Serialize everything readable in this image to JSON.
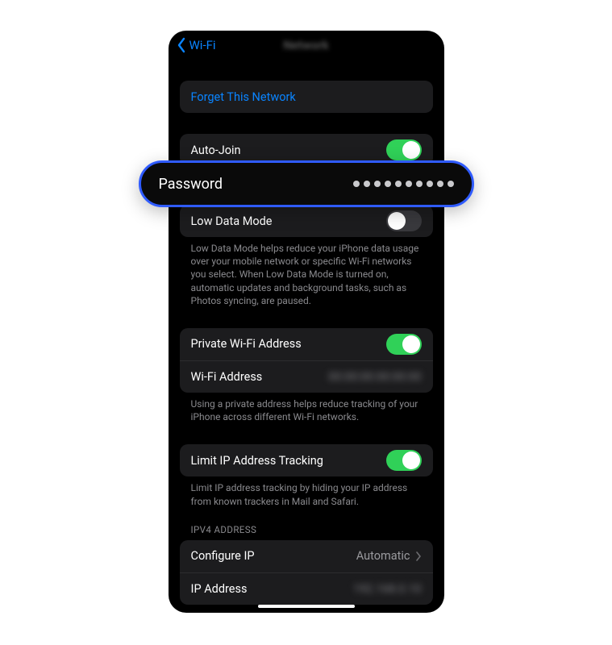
{
  "nav": {
    "back_label": "Wi-Fi",
    "title_blur": "Network"
  },
  "forget": {
    "label": "Forget This Network"
  },
  "auto_join": {
    "label": "Auto-Join",
    "on": true
  },
  "password": {
    "label": "Password",
    "mask_dots": 10
  },
  "low_data": {
    "label": "Low Data Mode",
    "on": false,
    "footer": "Low Data Mode helps reduce your iPhone data usage over your mobile network or specific Wi-Fi networks you select. When Low Data Mode is turned on, automatic updates and background tasks, such as Photos syncing, are paused."
  },
  "private_addr": {
    "label": "Private Wi-Fi Address",
    "on": true,
    "wifi_addr_label": "Wi-Fi Address",
    "wifi_addr_value": "00:00:00:00:00:00",
    "footer": "Using a private address helps reduce tracking of your iPhone across different Wi-Fi networks."
  },
  "limit_ip": {
    "label": "Limit IP Address Tracking",
    "on": true,
    "footer": "Limit IP address tracking by hiding your IP address from known trackers in Mail and Safari."
  },
  "ipv4": {
    "header": "IPV4 ADDRESS",
    "configure_label": "Configure IP",
    "configure_value": "Automatic",
    "ip_label": "IP Address",
    "ip_value": "192.168.0.10"
  }
}
